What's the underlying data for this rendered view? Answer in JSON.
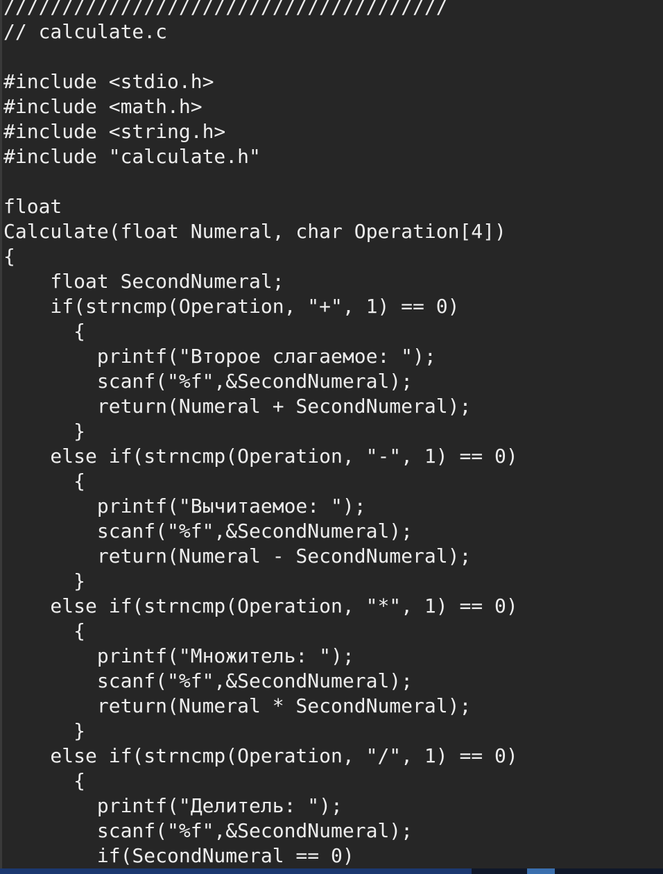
{
  "editor": {
    "lines": [
      "//////////////////////////////////////",
      "// calculate.c",
      "",
      "#include <stdio.h>",
      "#include <math.h>",
      "#include <string.h>",
      "#include \"calculate.h\"",
      "",
      "float",
      "Calculate(float Numeral, char Operation[4])",
      "{",
      "    float SecondNumeral;",
      "    if(strncmp(Operation, \"+\", 1) == 0)",
      "      {",
      "        printf(\"Второе слагаемое: \");",
      "        scanf(\"%f\",&SecondNumeral);",
      "        return(Numeral + SecondNumeral);",
      "      }",
      "    else if(strncmp(Operation, \"-\", 1) == 0)",
      "      {",
      "        printf(\"Вычитаемое: \");",
      "        scanf(\"%f\",&SecondNumeral);",
      "        return(Numeral - SecondNumeral);",
      "      }",
      "    else if(strncmp(Operation, \"*\", 1) == 0)",
      "      {",
      "        printf(\"Множитель: \");",
      "        scanf(\"%f\",&SecondNumeral);",
      "        return(Numeral * SecondNumeral);",
      "      }",
      "    else if(strncmp(Operation, \"/\", 1) == 0)",
      "      {",
      "        printf(\"Делитель: \");",
      "        scanf(\"%f\",&SecondNumeral);",
      "        if(SecondNumeral == 0)"
    ]
  },
  "colors": {
    "background": "#262626",
    "text": "#ededed",
    "desktop": "#1e3a6e"
  }
}
